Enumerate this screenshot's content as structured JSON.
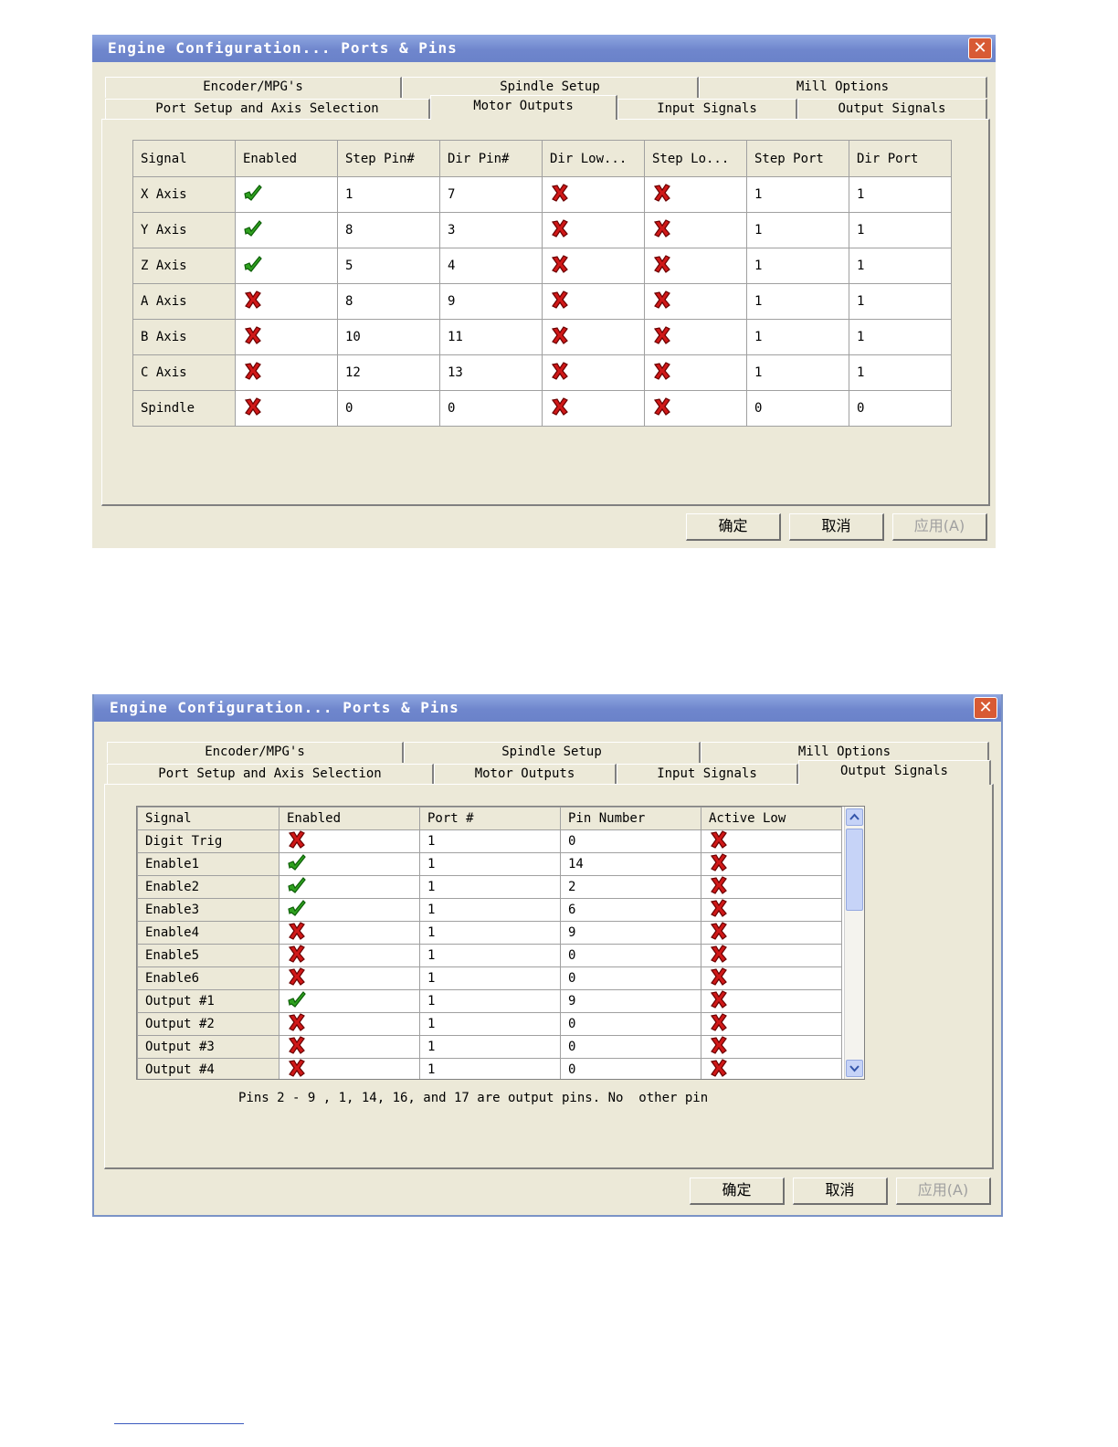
{
  "window1": {
    "title": "Engine Configuration... Ports & Pins",
    "tabs_row1": [
      "Encoder/MPG's",
      "Spindle Setup",
      "Mill Options"
    ],
    "tabs_row2": [
      "Port Setup and Axis Selection",
      "Motor Outputs",
      "Input Signals",
      "Output Signals"
    ],
    "active_tab": "Motor Outputs",
    "table": {
      "columns": [
        "Signal",
        "Enabled",
        "Step Pin#",
        "Dir Pin#",
        "Dir Low...",
        "Step Lo...",
        "Step Port",
        "Dir Port"
      ],
      "rows": [
        {
          "signal": "X Axis",
          "enabled": "check",
          "step_pin": "1",
          "dir_pin": "7",
          "dir_low": "x",
          "step_low": "x",
          "step_port": "1",
          "dir_port": "1"
        },
        {
          "signal": "Y Axis",
          "enabled": "check",
          "step_pin": "8",
          "dir_pin": "3",
          "dir_low": "x",
          "step_low": "x",
          "step_port": "1",
          "dir_port": "1"
        },
        {
          "signal": "Z Axis",
          "enabled": "check",
          "step_pin": "5",
          "dir_pin": "4",
          "dir_low": "x",
          "step_low": "x",
          "step_port": "1",
          "dir_port": "1"
        },
        {
          "signal": "A Axis",
          "enabled": "x",
          "step_pin": "8",
          "dir_pin": "9",
          "dir_low": "x",
          "step_low": "x",
          "step_port": "1",
          "dir_port": "1"
        },
        {
          "signal": "B Axis",
          "enabled": "x",
          "step_pin": "10",
          "dir_pin": "11",
          "dir_low": "x",
          "step_low": "x",
          "step_port": "1",
          "dir_port": "1"
        },
        {
          "signal": "C Axis",
          "enabled": "x",
          "step_pin": "12",
          "dir_pin": "13",
          "dir_low": "x",
          "step_low": "x",
          "step_port": "1",
          "dir_port": "1"
        },
        {
          "signal": "Spindle",
          "enabled": "x",
          "step_pin": "0",
          "dir_pin": "0",
          "dir_low": "x",
          "step_low": "x",
          "step_port": "0",
          "dir_port": "0"
        }
      ]
    },
    "buttons": {
      "ok": "确定",
      "cancel": "取消",
      "apply": "应用(A)"
    }
  },
  "window2": {
    "title": "Engine Configuration... Ports & Pins",
    "tabs_row1": [
      "Encoder/MPG's",
      "Spindle Setup",
      "Mill Options"
    ],
    "tabs_row2": [
      "Port Setup and Axis Selection",
      "Motor Outputs",
      "Input Signals",
      "Output Signals"
    ],
    "active_tab": "Output Signals",
    "table": {
      "columns": [
        "Signal",
        "Enabled",
        "Port #",
        "Pin Number",
        "Active Low"
      ],
      "rows": [
        {
          "signal": "Digit Trig",
          "enabled": "x",
          "port": "1",
          "pin": "0",
          "active_low": "x"
        },
        {
          "signal": "Enable1",
          "enabled": "check",
          "port": "1",
          "pin": "14",
          "active_low": "x"
        },
        {
          "signal": "Enable2",
          "enabled": "check",
          "port": "1",
          "pin": "2",
          "active_low": "x"
        },
        {
          "signal": "Enable3",
          "enabled": "check",
          "port": "1",
          "pin": "6",
          "active_low": "x"
        },
        {
          "signal": "Enable4",
          "enabled": "x",
          "port": "1",
          "pin": "9",
          "active_low": "x"
        },
        {
          "signal": "Enable5",
          "enabled": "x",
          "port": "1",
          "pin": "0",
          "active_low": "x"
        },
        {
          "signal": "Enable6",
          "enabled": "x",
          "port": "1",
          "pin": "0",
          "active_low": "x"
        },
        {
          "signal": "Output #1",
          "enabled": "check",
          "port": "1",
          "pin": "9",
          "active_low": "x"
        },
        {
          "signal": "Output #2",
          "enabled": "x",
          "port": "1",
          "pin": "0",
          "active_low": "x"
        },
        {
          "signal": "Output #3",
          "enabled": "x",
          "port": "1",
          "pin": "0",
          "active_low": "x"
        },
        {
          "signal": "Output #4",
          "enabled": "x",
          "port": "1",
          "pin": "0",
          "active_low": "x"
        }
      ]
    },
    "note": "Pins 2 - 9 , 1, 14, 16, and 17 are output pins. No  other pin",
    "buttons": {
      "ok": "确定",
      "cancel": "取消",
      "apply": "应用(A)"
    }
  },
  "icons": {
    "enabled_true": "green-check-icon",
    "enabled_false": "red-x-icon"
  },
  "colors": {
    "titlebar": "#7a90d6",
    "check_green": "#2fa11f",
    "x_red": "#d01818",
    "dialog_bg": "#ece9d8"
  }
}
